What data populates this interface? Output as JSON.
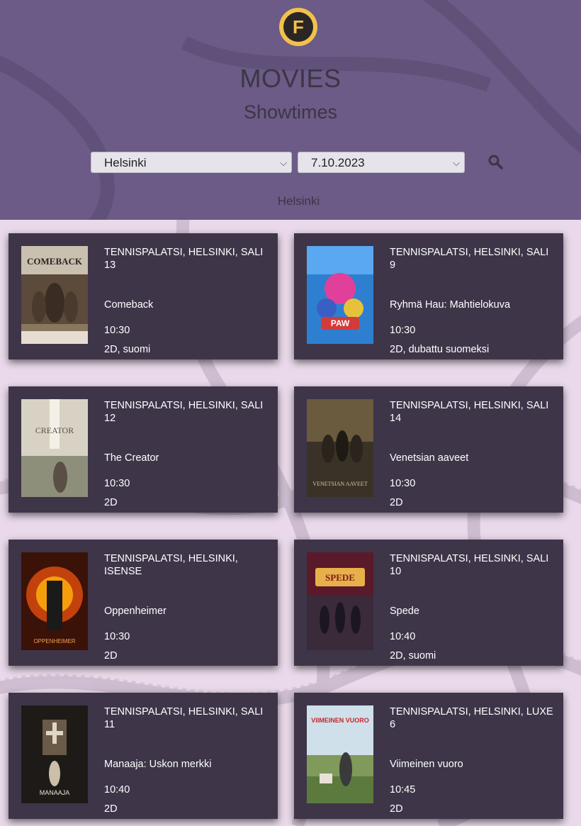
{
  "header": {
    "logo_letter": "F",
    "title": "MOVIES",
    "subtitle": "Showtimes",
    "city_select": "Helsinki",
    "date_select": "7.10.2023",
    "location_label": "Helsinki"
  },
  "colors": {
    "header_bg": "#6b5b86",
    "page_bg": "#e9d9ea",
    "card_bg": "#3e3549",
    "logo_yellow": "#f2c14b"
  },
  "showtimes": [
    {
      "venue": "TENNISPALATSI, HELSINKI, SALI 13",
      "movie": "Comeback",
      "time": "10:30",
      "format": "2D, suomi",
      "poster_text": "COMEBACK"
    },
    {
      "venue": "TENNISPALATSI, HELSINKI, SALI 9",
      "movie": "Ryhmä Hau: Mahtielokuva",
      "time": "10:30",
      "format": "2D, dubattu suomeksi",
      "poster_text": "PAW"
    },
    {
      "venue": "TENNISPALATSI, HELSINKI, SALI 12",
      "movie": "The Creator",
      "time": "10:30",
      "format": "2D",
      "poster_text": "CREATOR"
    },
    {
      "venue": "TENNISPALATSI, HELSINKI, SALI 14",
      "movie": "Venetsian aaveet",
      "time": "10:30",
      "format": "2D",
      "poster_text": "VENETSIAN AAVEET"
    },
    {
      "venue": "TENNISPALATSI, HELSINKI, ISENSE",
      "movie": "Oppenheimer",
      "time": "10:30",
      "format": "2D",
      "poster_text": "OPPENHEIMER"
    },
    {
      "venue": "TENNISPALATSI, HELSINKI, SALI 10",
      "movie": "Spede",
      "time": "10:40",
      "format": "2D, suomi",
      "poster_text": "SPEDE"
    },
    {
      "venue": "TENNISPALATSI, HELSINKI, SALI 11",
      "movie": "Manaaja: Uskon merkki",
      "time": "10:40",
      "format": "2D",
      "poster_text": "MANAAJA"
    },
    {
      "venue": "TENNISPALATSI, HELSINKI, LUXE 6",
      "movie": "Viimeinen vuoro",
      "time": "10:45",
      "format": "2D",
      "poster_text": "VIIMEINEN VUORO"
    }
  ]
}
